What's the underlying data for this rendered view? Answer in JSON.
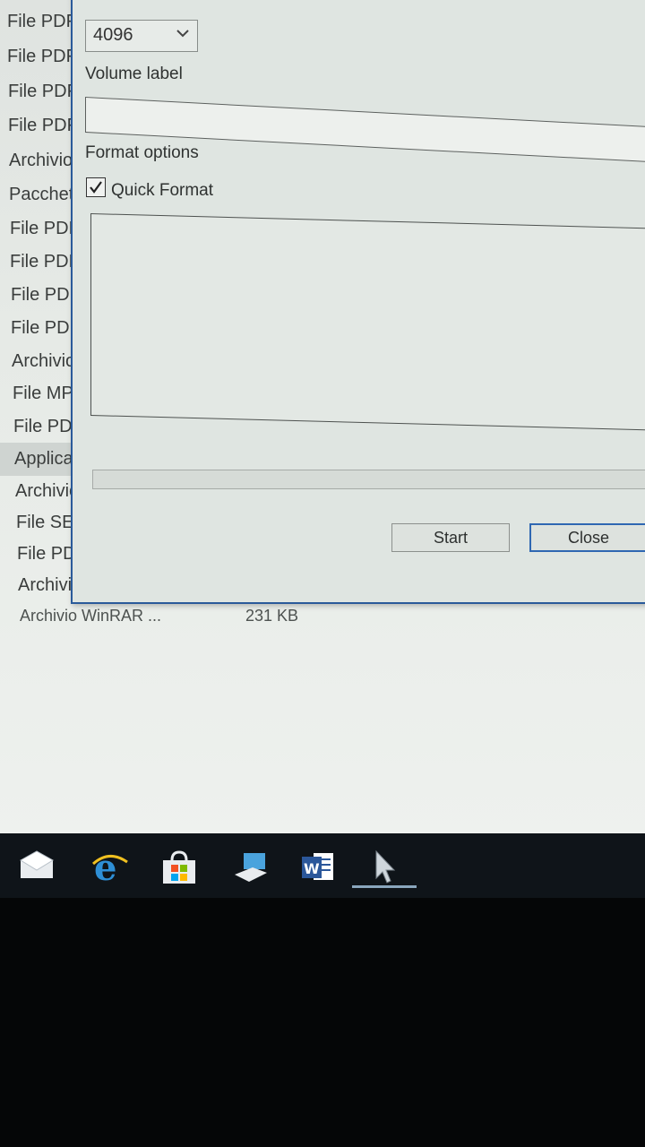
{
  "file_list": {
    "rows": [
      "File PDF",
      "File PDF",
      "File PDF",
      "File PDF",
      "Archivio",
      "Pacchetto",
      "File PDF",
      "File PDF",
      "File PDF",
      "File PDF",
      "Archivio",
      "File MP",
      "File PDF",
      "Applica",
      "Archivio",
      "File SED",
      "File PDF",
      "Archivio"
    ],
    "last_row": {
      "type": "Archivio WinRAR ...",
      "size": "231 KB"
    }
  },
  "dialog": {
    "allocation_unit_value": "4096",
    "volume_label": "Volume label",
    "volume_label_value": "",
    "format_options": "Format options",
    "quick_format_label": "Quick Format",
    "quick_format_checked": true,
    "start_label": "Start",
    "close_label": "Close"
  },
  "taskbar": {
    "icons": [
      "mail-icon",
      "edge-icon",
      "store-icon",
      "network-icon",
      "word-icon",
      "cursor-app-icon"
    ],
    "active_icon": "cursor-app-icon",
    "accent": "#2f67b2"
  }
}
